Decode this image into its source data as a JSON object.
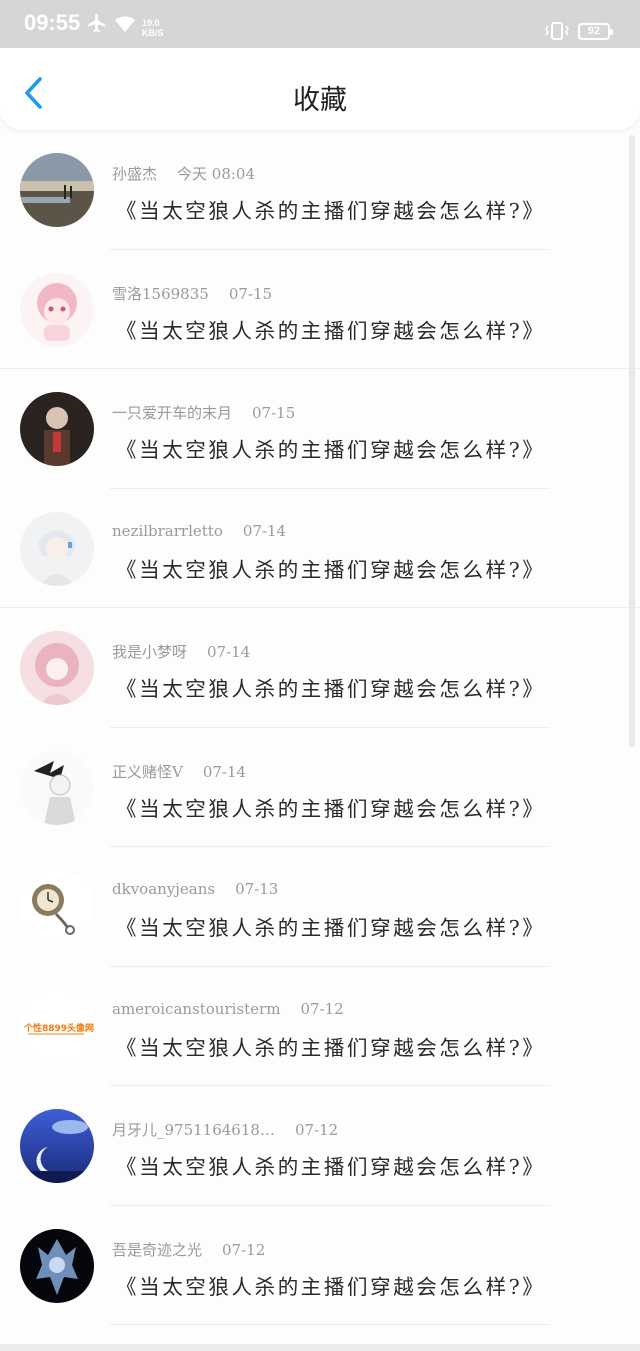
{
  "status": {
    "time": "09:55",
    "speed_value": "19.0",
    "speed_unit": "KB/S",
    "battery": "92"
  },
  "header": {
    "title": "收藏"
  },
  "items": [
    {
      "user": "孙盛杰",
      "time": "今天 08:04",
      "text": "《当太空狼人杀的主播们穿越会怎么样?》"
    },
    {
      "user": "雪洛1569835",
      "time": "07-15",
      "text": "《当太空狼人杀的主播们穿越会怎么样?》"
    },
    {
      "user": "一只爱开车的末月",
      "time": "07-15",
      "text": "《当太空狼人杀的主播们穿越会怎么样?》"
    },
    {
      "user": "nezilbrarrletto",
      "time": "07-14",
      "text": "《当太空狼人杀的主播们穿越会怎么样?》"
    },
    {
      "user": "我是小梦呀",
      "time": "07-14",
      "text": "《当太空狼人杀的主播们穿越会怎么样?》"
    },
    {
      "user": "正义赌怪V",
      "time": "07-14",
      "text": "《当太空狼人杀的主播们穿越会怎么样?》"
    },
    {
      "user": "dkvoanyjeans",
      "time": "07-13",
      "text": "《当太空狼人杀的主播们穿越会怎么样?》"
    },
    {
      "user": "ameroicanstouristerm",
      "time": "07-12",
      "text": "《当太空狼人杀的主播们穿越会怎么样?》"
    },
    {
      "user": "月牙儿_9751164618…",
      "time": "07-12",
      "text": "《当太空狼人杀的主播们穿越会怎么样?》"
    },
    {
      "user": "吾是奇迹之光",
      "time": "07-12",
      "text": "《当太空狼人杀的主播们穿越会怎么样?》"
    }
  ],
  "avatar_watermark": "个性8899头像网"
}
